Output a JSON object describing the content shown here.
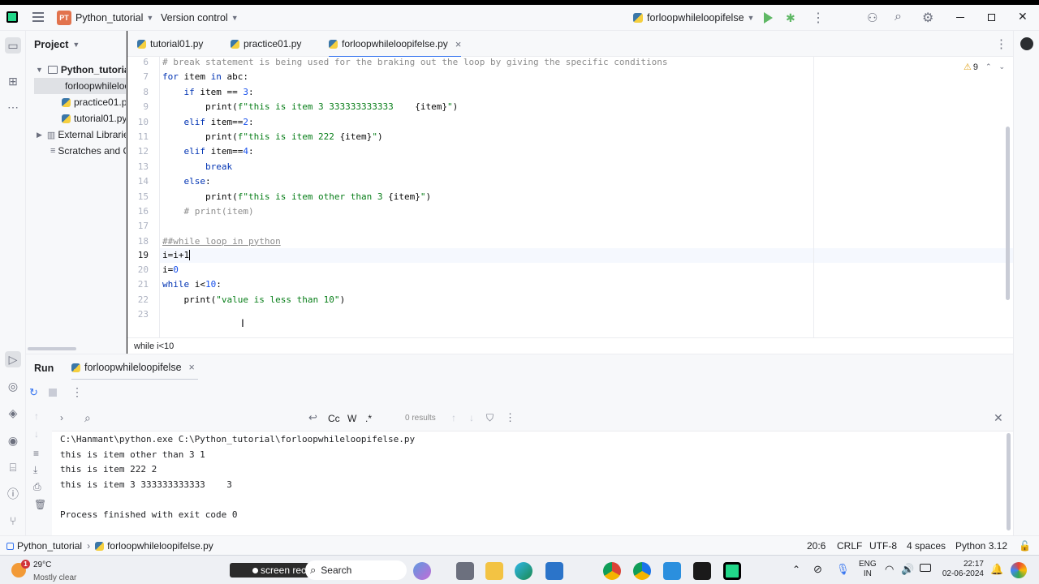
{
  "titlebar": {
    "project_badge": "PT",
    "project_name": "Python_tutorial",
    "vcs": "Version control",
    "run_config": "forloopwhileloopifelse"
  },
  "project_panel": {
    "title": "Project",
    "items": [
      {
        "label": "Python_tutorial"
      },
      {
        "label": "forloopwhileloopifelse.py"
      },
      {
        "label": "practice01.py"
      },
      {
        "label": "tutorial01.py"
      },
      {
        "label": "External Libraries"
      },
      {
        "label": "Scratches and Consoles"
      }
    ]
  },
  "tabs": [
    {
      "label": "tutorial01.py"
    },
    {
      "label": "practice01.py"
    },
    {
      "label": "forloopwhileloopifelse.py",
      "close": "×"
    }
  ],
  "editor": {
    "warnings": "9",
    "line_numbers": [
      "6",
      "7",
      "8",
      "9",
      "10",
      "11",
      "12",
      "13",
      "14",
      "15",
      "16",
      "17",
      "18",
      "19",
      "20",
      "21",
      "22",
      "23"
    ],
    "breadcrumb": "while i<10"
  },
  "run": {
    "title": "Run",
    "tab_label": "forloopwhileloopifelse",
    "close": "×",
    "search_results": "0 results",
    "match_case": "Cc",
    "words": "W",
    "regex": ".*",
    "output": [
      "C:\\Hanmant\\python.exe C:\\Python_tutorial\\forloopwhileloopifelse.py",
      "this is item other than 3 1",
      "this is item 222 2",
      "this is item 3 333333333333    3",
      "",
      "Process finished with exit code 0"
    ]
  },
  "statusbar": {
    "path_project": "Python_tutorial",
    "path_file": "forloopwhileloopifelse.py",
    "position": "20:6",
    "line_sep": "CRLF",
    "encoding": "UTF-8",
    "indent": "4 spaces",
    "interpreter": "Python 3.12"
  },
  "taskbar": {
    "temp": "29°C",
    "weather": "Mostly clear",
    "weather_badge": "1",
    "screenrec": "screen rec",
    "search": "Search",
    "lang": "ENG",
    "lang2": "IN",
    "time": "22:17",
    "date": "02-06-2024"
  },
  "colors": {
    "accent": "#3574f0",
    "keyword": "#0033b3",
    "string": "#067d17",
    "comment": "#8c8c8c",
    "number": "#1750eb"
  }
}
